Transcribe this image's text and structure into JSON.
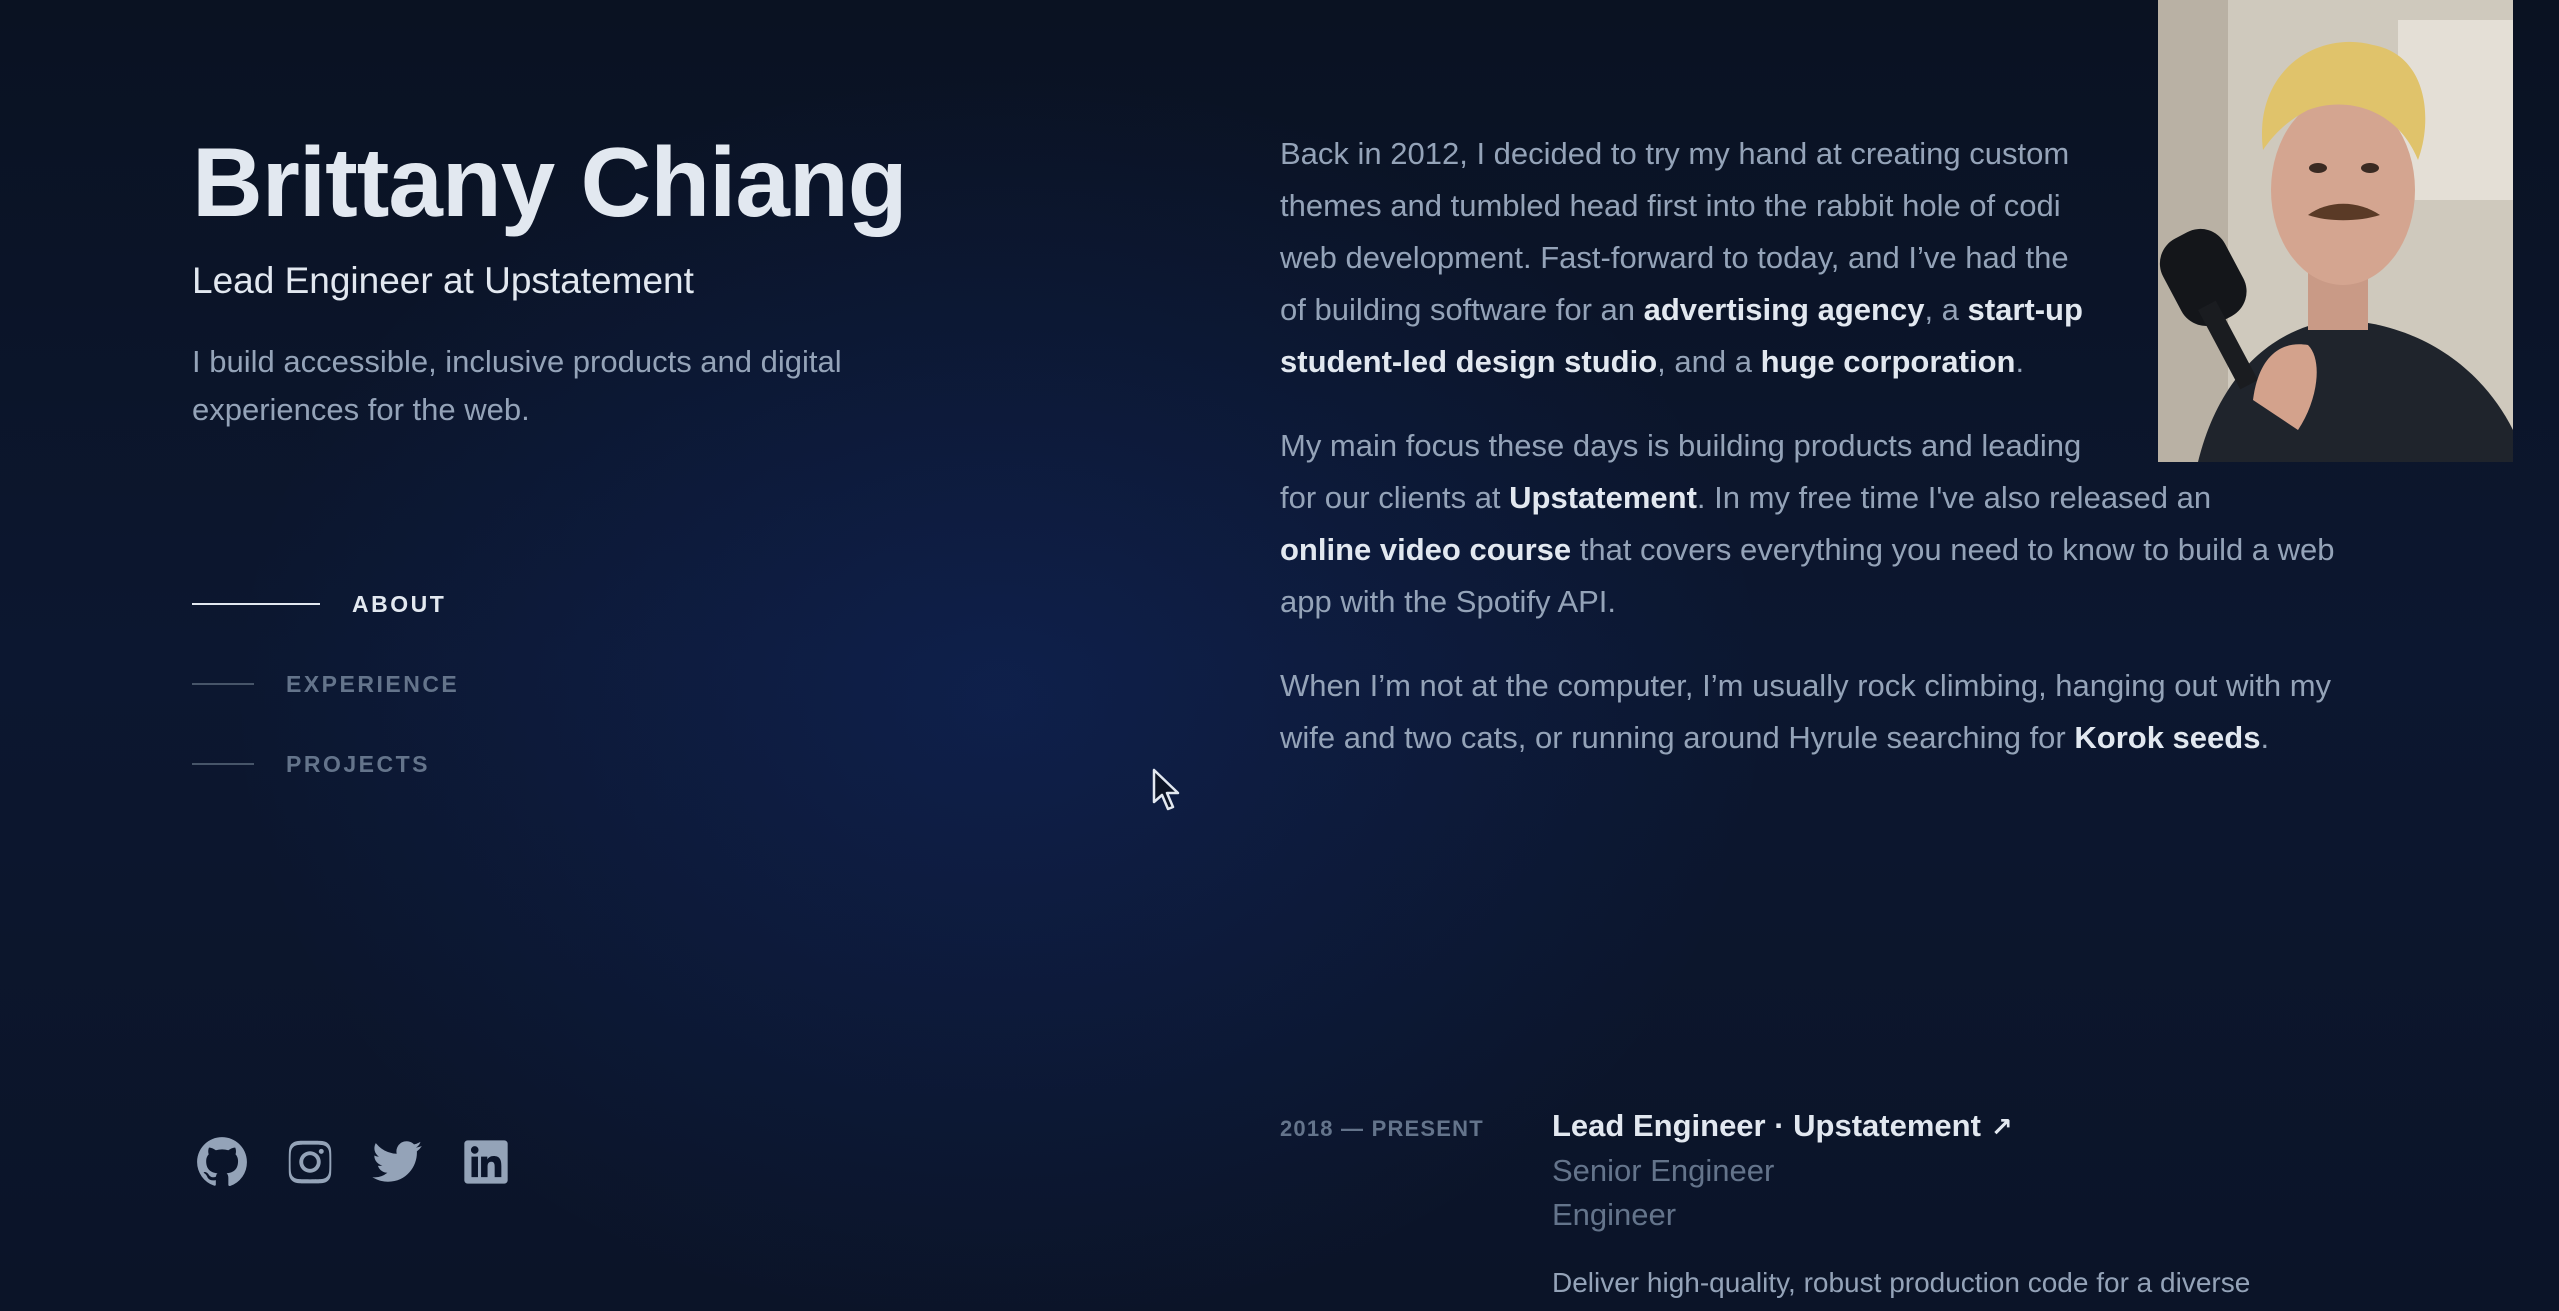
{
  "header": {
    "name": "Brittany Chiang",
    "role": "Lead Engineer at Upstatement",
    "tagline": "I build accessible, inclusive products and digital experiences for the web."
  },
  "nav": {
    "items": [
      {
        "label": "ABOUT",
        "active": true
      },
      {
        "label": "EXPERIENCE",
        "active": false
      },
      {
        "label": "PROJECTS",
        "active": false
      }
    ]
  },
  "socials": [
    {
      "icon": "github-icon"
    },
    {
      "icon": "instagram-icon"
    },
    {
      "icon": "twitter-icon"
    },
    {
      "icon": "linkedin-icon"
    }
  ],
  "about": {
    "p1": {
      "t1": "Back in 2012, I decided to try my hand at creating custom",
      "t2": "themes and tumbled head first into the rabbit hole of codi",
      "t3": "web development. Fast-forward to today, and I’ve had the",
      "t4": "of building software for an ",
      "h1": "advertising agency",
      "t5": ", a ",
      "h2": "start-up",
      "h3": "student-led design studio",
      "t6": ", and a ",
      "h4": "huge corporation",
      "t7": "."
    },
    "p2": {
      "t1": "My main focus these days is building products and leading",
      "t2": "for our clients at ",
      "h1": "Upstatement",
      "t3": ". In my free time I've also released an",
      "h2": "online video course",
      "t4": " that covers everything you need to know to build a web app with the Spotify API."
    },
    "p3": {
      "t1": "When I’m not at the computer, I’m usually rock climbing, hanging out with my wife and two cats, or running around Hyrule searching for ",
      "h1": "Korok seeds",
      "t2": "."
    }
  },
  "experience": {
    "date": "2018 — PRESENT",
    "title": "Lead Engineer · Upstatement",
    "sub1": "Senior Engineer",
    "sub2": "Engineer",
    "desc": "Deliver high-quality, robust production code for a diverse"
  }
}
